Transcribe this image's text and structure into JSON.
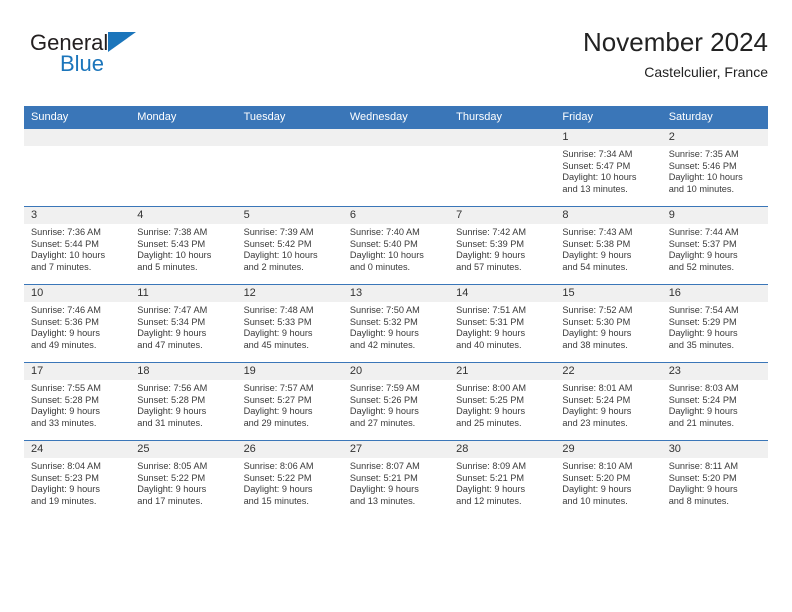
{
  "brand": {
    "word1": "General",
    "word2": "Blue",
    "logo_color": "#1b75bb"
  },
  "header": {
    "title": "November 2024",
    "location": "Castelculier, France"
  },
  "calendar": {
    "header_bg": "#3a76b8",
    "daynum_bg": "#f0f0f0",
    "weekday_headers": [
      "Sunday",
      "Monday",
      "Tuesday",
      "Wednesday",
      "Thursday",
      "Friday",
      "Saturday"
    ],
    "weeks": [
      [
        {
          "day": "",
          "lines": []
        },
        {
          "day": "",
          "lines": []
        },
        {
          "day": "",
          "lines": []
        },
        {
          "day": "",
          "lines": []
        },
        {
          "day": "",
          "lines": []
        },
        {
          "day": "1",
          "lines": [
            "Sunrise: 7:34 AM",
            "Sunset: 5:47 PM",
            "Daylight: 10 hours",
            "and 13 minutes."
          ]
        },
        {
          "day": "2",
          "lines": [
            "Sunrise: 7:35 AM",
            "Sunset: 5:46 PM",
            "Daylight: 10 hours",
            "and 10 minutes."
          ]
        }
      ],
      [
        {
          "day": "3",
          "lines": [
            "Sunrise: 7:36 AM",
            "Sunset: 5:44 PM",
            "Daylight: 10 hours",
            "and 7 minutes."
          ]
        },
        {
          "day": "4",
          "lines": [
            "Sunrise: 7:38 AM",
            "Sunset: 5:43 PM",
            "Daylight: 10 hours",
            "and 5 minutes."
          ]
        },
        {
          "day": "5",
          "lines": [
            "Sunrise: 7:39 AM",
            "Sunset: 5:42 PM",
            "Daylight: 10 hours",
            "and 2 minutes."
          ]
        },
        {
          "day": "6",
          "lines": [
            "Sunrise: 7:40 AM",
            "Sunset: 5:40 PM",
            "Daylight: 10 hours",
            "and 0 minutes."
          ]
        },
        {
          "day": "7",
          "lines": [
            "Sunrise: 7:42 AM",
            "Sunset: 5:39 PM",
            "Daylight: 9 hours",
            "and 57 minutes."
          ]
        },
        {
          "day": "8",
          "lines": [
            "Sunrise: 7:43 AM",
            "Sunset: 5:38 PM",
            "Daylight: 9 hours",
            "and 54 minutes."
          ]
        },
        {
          "day": "9",
          "lines": [
            "Sunrise: 7:44 AM",
            "Sunset: 5:37 PM",
            "Daylight: 9 hours",
            "and 52 minutes."
          ]
        }
      ],
      [
        {
          "day": "10",
          "lines": [
            "Sunrise: 7:46 AM",
            "Sunset: 5:36 PM",
            "Daylight: 9 hours",
            "and 49 minutes."
          ]
        },
        {
          "day": "11",
          "lines": [
            "Sunrise: 7:47 AM",
            "Sunset: 5:34 PM",
            "Daylight: 9 hours",
            "and 47 minutes."
          ]
        },
        {
          "day": "12",
          "lines": [
            "Sunrise: 7:48 AM",
            "Sunset: 5:33 PM",
            "Daylight: 9 hours",
            "and 45 minutes."
          ]
        },
        {
          "day": "13",
          "lines": [
            "Sunrise: 7:50 AM",
            "Sunset: 5:32 PM",
            "Daylight: 9 hours",
            "and 42 minutes."
          ]
        },
        {
          "day": "14",
          "lines": [
            "Sunrise: 7:51 AM",
            "Sunset: 5:31 PM",
            "Daylight: 9 hours",
            "and 40 minutes."
          ]
        },
        {
          "day": "15",
          "lines": [
            "Sunrise: 7:52 AM",
            "Sunset: 5:30 PM",
            "Daylight: 9 hours",
            "and 38 minutes."
          ]
        },
        {
          "day": "16",
          "lines": [
            "Sunrise: 7:54 AM",
            "Sunset: 5:29 PM",
            "Daylight: 9 hours",
            "and 35 minutes."
          ]
        }
      ],
      [
        {
          "day": "17",
          "lines": [
            "Sunrise: 7:55 AM",
            "Sunset: 5:28 PM",
            "Daylight: 9 hours",
            "and 33 minutes."
          ]
        },
        {
          "day": "18",
          "lines": [
            "Sunrise: 7:56 AM",
            "Sunset: 5:28 PM",
            "Daylight: 9 hours",
            "and 31 minutes."
          ]
        },
        {
          "day": "19",
          "lines": [
            "Sunrise: 7:57 AM",
            "Sunset: 5:27 PM",
            "Daylight: 9 hours",
            "and 29 minutes."
          ]
        },
        {
          "day": "20",
          "lines": [
            "Sunrise: 7:59 AM",
            "Sunset: 5:26 PM",
            "Daylight: 9 hours",
            "and 27 minutes."
          ]
        },
        {
          "day": "21",
          "lines": [
            "Sunrise: 8:00 AM",
            "Sunset: 5:25 PM",
            "Daylight: 9 hours",
            "and 25 minutes."
          ]
        },
        {
          "day": "22",
          "lines": [
            "Sunrise: 8:01 AM",
            "Sunset: 5:24 PM",
            "Daylight: 9 hours",
            "and 23 minutes."
          ]
        },
        {
          "day": "23",
          "lines": [
            "Sunrise: 8:03 AM",
            "Sunset: 5:24 PM",
            "Daylight: 9 hours",
            "and 21 minutes."
          ]
        }
      ],
      [
        {
          "day": "24",
          "lines": [
            "Sunrise: 8:04 AM",
            "Sunset: 5:23 PM",
            "Daylight: 9 hours",
            "and 19 minutes."
          ]
        },
        {
          "day": "25",
          "lines": [
            "Sunrise: 8:05 AM",
            "Sunset: 5:22 PM",
            "Daylight: 9 hours",
            "and 17 minutes."
          ]
        },
        {
          "day": "26",
          "lines": [
            "Sunrise: 8:06 AM",
            "Sunset: 5:22 PM",
            "Daylight: 9 hours",
            "and 15 minutes."
          ]
        },
        {
          "day": "27",
          "lines": [
            "Sunrise: 8:07 AM",
            "Sunset: 5:21 PM",
            "Daylight: 9 hours",
            "and 13 minutes."
          ]
        },
        {
          "day": "28",
          "lines": [
            "Sunrise: 8:09 AM",
            "Sunset: 5:21 PM",
            "Daylight: 9 hours",
            "and 12 minutes."
          ]
        },
        {
          "day": "29",
          "lines": [
            "Sunrise: 8:10 AM",
            "Sunset: 5:20 PM",
            "Daylight: 9 hours",
            "and 10 minutes."
          ]
        },
        {
          "day": "30",
          "lines": [
            "Sunrise: 8:11 AM",
            "Sunset: 5:20 PM",
            "Daylight: 9 hours",
            "and 8 minutes."
          ]
        }
      ]
    ]
  }
}
